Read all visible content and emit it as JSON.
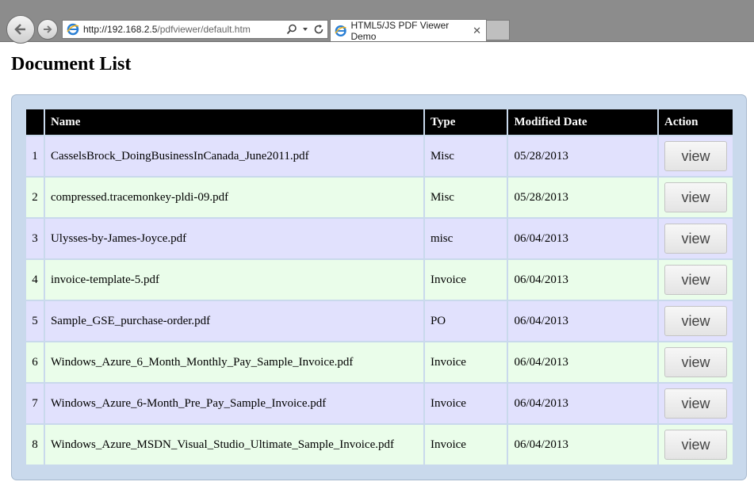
{
  "browser": {
    "url_host": "http://192.168.2.5",
    "url_path": "/pdfviewer/default.htm",
    "tab_title": "HTML5/JS PDF Viewer Demo",
    "tab_close": "✕"
  },
  "page": {
    "title": "Document List"
  },
  "table": {
    "headers": [
      "",
      "Name",
      "Type",
      "Modified Date",
      "Action"
    ],
    "rows": [
      {
        "num": "1",
        "name": "CasselsBrock_DoingBusinessInCanada_June2011.pdf",
        "type": "Misc",
        "date": "05/28/2013",
        "action": "view"
      },
      {
        "num": "2",
        "name": "compressed.tracemonkey-pldi-09.pdf",
        "type": "Misc",
        "date": "05/28/2013",
        "action": "view"
      },
      {
        "num": "3",
        "name": "Ulysses-by-James-Joyce.pdf",
        "type": "misc",
        "date": "06/04/2013",
        "action": "view"
      },
      {
        "num": "4",
        "name": "invoice-template-5.pdf",
        "type": "Invoice",
        "date": "06/04/2013",
        "action": "view"
      },
      {
        "num": "5",
        "name": "Sample_GSE_purchase-order.pdf",
        "type": "PO",
        "date": "06/04/2013",
        "action": "view"
      },
      {
        "num": "6",
        "name": "Windows_Azure_6_Month_Monthly_Pay_Sample_Invoice.pdf",
        "type": "Invoice",
        "date": "06/04/2013",
        "action": "view"
      },
      {
        "num": "7",
        "name": "Windows_Azure_6-Month_Pre_Pay_Sample_Invoice.pdf",
        "type": "Invoice",
        "date": "06/04/2013",
        "action": "view"
      },
      {
        "num": "8",
        "name": "Windows_Azure_MSDN_Visual_Studio_Ultimate_Sample_Invoice.pdf",
        "type": "Invoice",
        "date": "06/04/2013",
        "action": "view"
      }
    ]
  }
}
